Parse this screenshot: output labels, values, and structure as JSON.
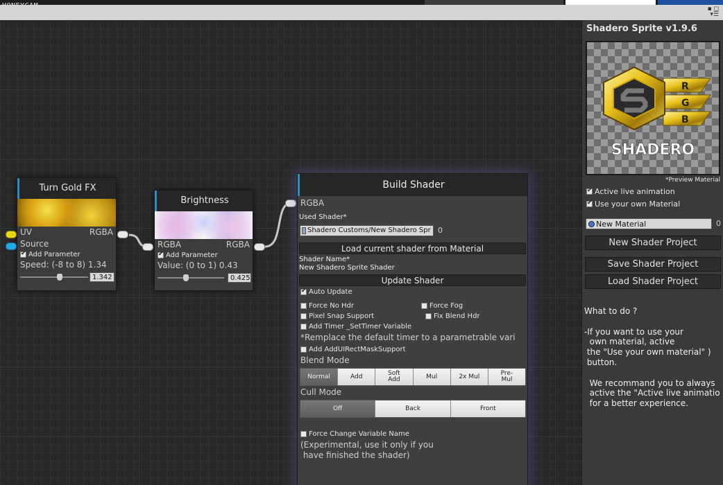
{
  "watermark": "HONEYCAM",
  "canvas": {
    "turn_gold": {
      "title": "Turn Gold FX",
      "port_uv": "UV",
      "port_source": "Source",
      "port_out": "RGBA",
      "add_param": "Add Parameter",
      "speed_label": "Speed: (-8 to 8) 1.34",
      "speed_value": "1.342",
      "speed_fraction": 0.58
    },
    "brightness": {
      "title": "Brightness",
      "port_in": "RGBA",
      "port_out": "RGBA",
      "add_param": "Add Parameter",
      "value_label": "Value: (0 to 1) 0.43",
      "value_value": "0.425",
      "value_fraction": 0.425
    },
    "build": {
      "title": "Build Shader",
      "port_in": "RGBA",
      "used_shader_label": "Used Shader*",
      "used_shader_value": "Shadero Customs/New Shadero Spr",
      "used_shader_extra": "0",
      "load_btn": "Load current shader from Material",
      "shader_name_label": "Shader Name*",
      "shader_name_value": "New Shadero Sprite Shader",
      "update_btn": "Update Shader",
      "auto_update": "Auto Update",
      "force_no_hdr": "Force No Hdr",
      "force_fog": "Force Fog",
      "pixel_snap": "Pixel Snap Support",
      "fix_blend_hdr": "Fix Blend Hdr",
      "add_timer": "Add Timer _SetTimer Variable",
      "timer_note": "*Remplace the default timer to a parametrable vari",
      "add_mask": "Add AddUIRectMaskSupport",
      "blend_mode_label": "Blend Mode",
      "blend_modes": [
        "Normal",
        "Add",
        "Soft\nAdd",
        "Mul",
        "2x Mul",
        "Pre-\nMul"
      ],
      "cull_mode_label": "Cull Mode",
      "cull_modes": [
        "Off",
        "Back",
        "Front"
      ],
      "force_change": "Force Change Variable Name",
      "experimental": "(Experimental, use it only if you\n have finished the shader)"
    }
  },
  "inspector": {
    "title": "Shadero Sprite v1.9.6",
    "logo_text": "SHADERO",
    "logo_letters": [
      "R",
      "G",
      "B"
    ],
    "preview_note": "*Preview Material",
    "active_live": "Active live animation",
    "use_own": "Use your own Material",
    "material_field": "New Material",
    "material_extra": "0",
    "new_project": "New Shader Project",
    "save_project": "Save Shader Project",
    "load_project": "Load Shader Project",
    "help": "What to do ?\n\n-If you want to use your\n  own material, active\n the \"Use your own material\" )\n button.\n\n  We recommand you to always\n  active the \"Active live animatio\n  for a better experience."
  },
  "colors": {
    "accent": "#2f8cc4",
    "gold": "#e8c21a",
    "uv_pin": "#e8d613",
    "source_pin": "#23a9e8"
  }
}
